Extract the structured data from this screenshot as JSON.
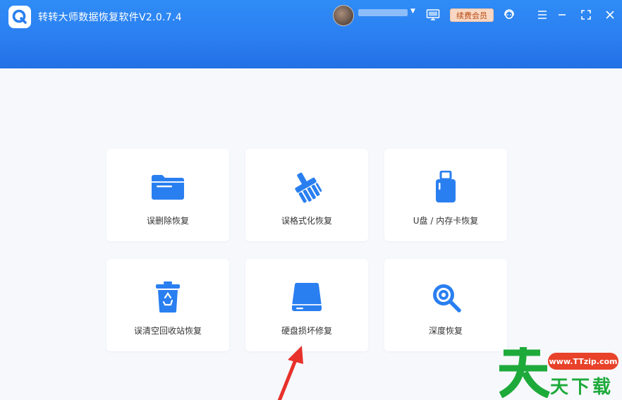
{
  "app": {
    "title": "转转大师数据恢复软件V2.0.7.4",
    "username": "",
    "renew_label": "续费会员"
  },
  "colors": {
    "header": "#2b7ff0",
    "accent": "#2a7ff0",
    "renew_bg": "#f8d8c4",
    "renew_text": "#b9480f",
    "annotation_arrow": "#e8312a"
  },
  "icons": [
    "logo-icon",
    "avatar",
    "monitor-icon",
    "headset-icon",
    "menu-icon",
    "minimize-icon",
    "maximize-icon",
    "close-icon"
  ],
  "cards": [
    {
      "label": "误删除恢复",
      "icon": "folder-icon"
    },
    {
      "label": "误格式化恢复",
      "icon": "broom-icon"
    },
    {
      "label": "U盘 / 内存卡恢复",
      "icon": "usb-drive-icon"
    },
    {
      "label": "误清空回收站恢复",
      "icon": "recycle-bin-icon"
    },
    {
      "label": "硬盘损坏修复",
      "icon": "hard-disk-icon"
    },
    {
      "label": "深度恢复",
      "icon": "deep-scan-icon"
    }
  ],
  "watermark": {
    "logo_char": "天",
    "url": "www.TTzip.com",
    "name": "天下载"
  }
}
